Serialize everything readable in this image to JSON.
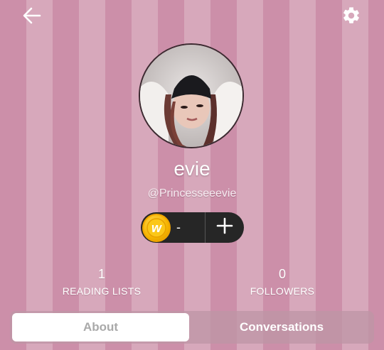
{
  "header": {
    "back_icon": "arrow-left-icon",
    "settings_icon": "gear-icon"
  },
  "profile": {
    "display_name": "evie",
    "username": "@Princesseeevie",
    "avatar": "profile-photo"
  },
  "coins": {
    "icon": "wattpad-coin-icon",
    "coin_letter": "w",
    "count": "-",
    "add_icon": "plus-icon"
  },
  "stats": [
    {
      "value": "1",
      "label": "READING LISTS"
    },
    {
      "value": "0",
      "label": "FOLLOWERS"
    }
  ],
  "tabs": [
    {
      "label": "About",
      "active": true
    },
    {
      "label": "Conversations",
      "active": false
    }
  ],
  "colors": {
    "stripe_dark": "#cc8fa9",
    "stripe_light": "#d7a8bb",
    "coin_gold": "#f5b400",
    "pill_bg": "#262626"
  }
}
